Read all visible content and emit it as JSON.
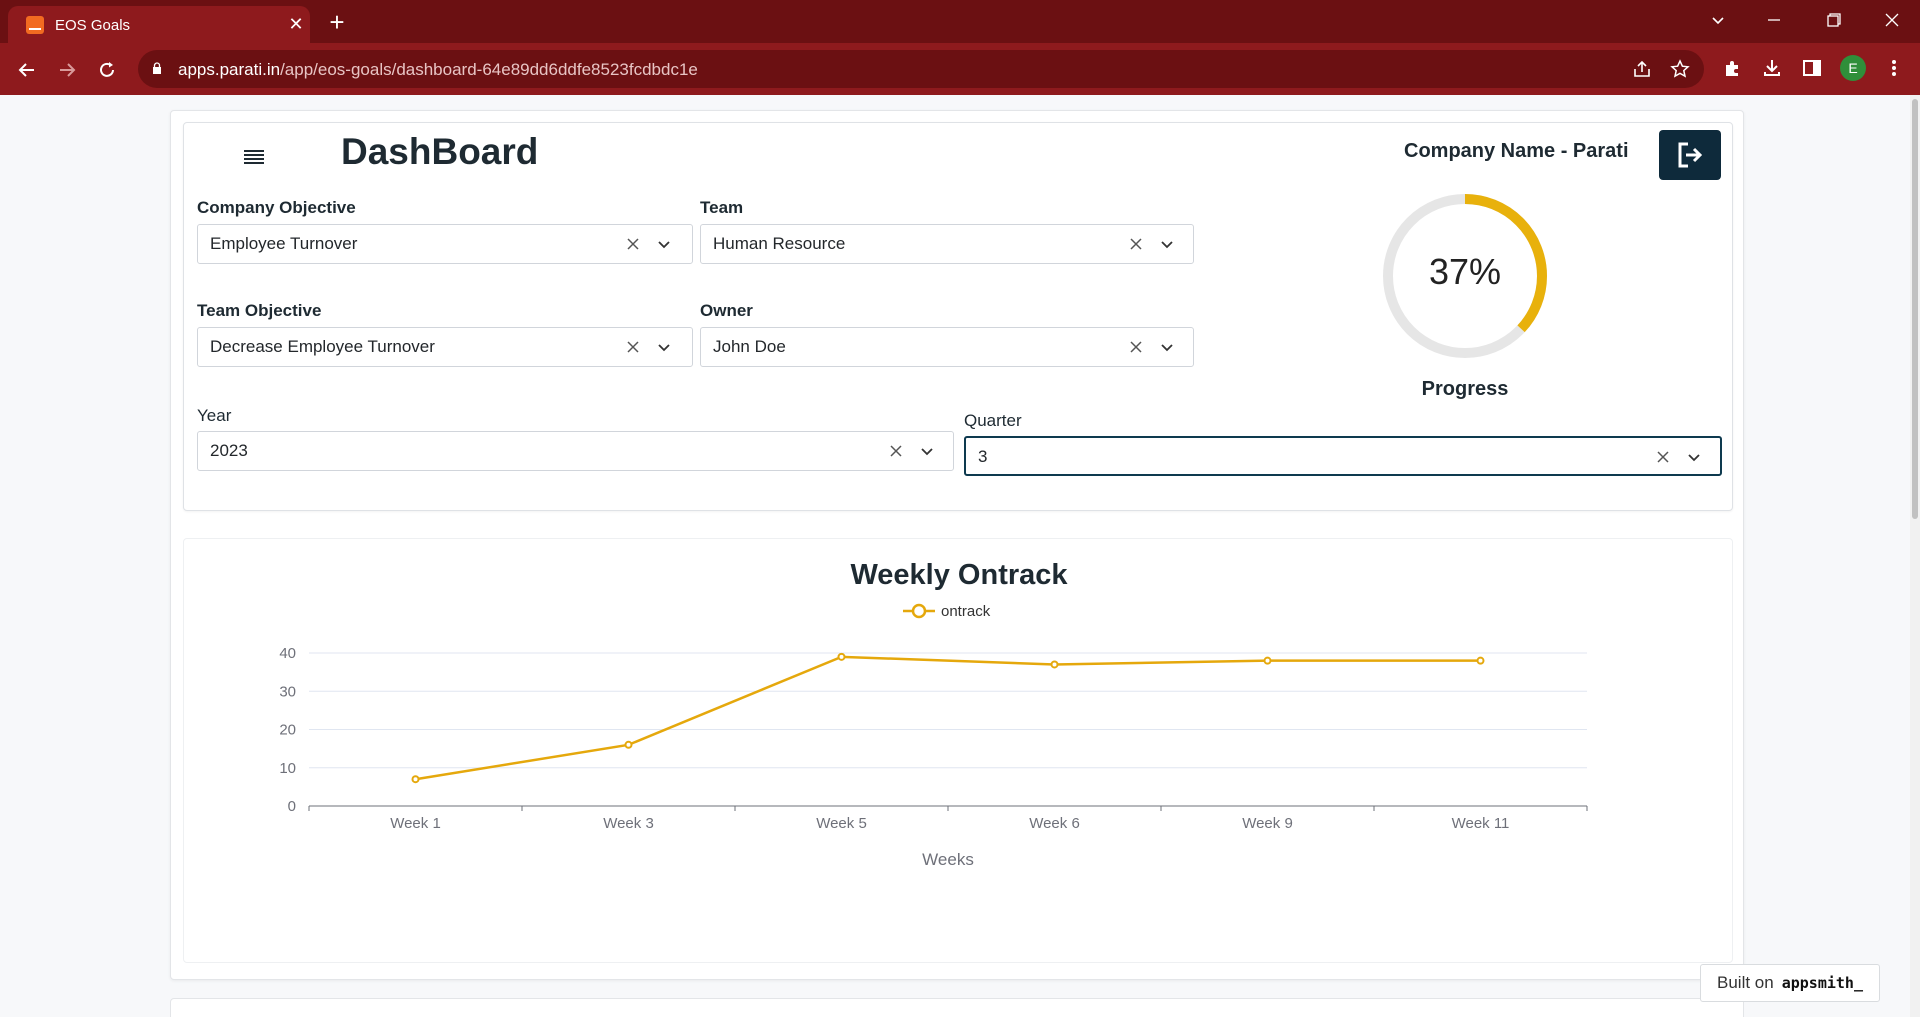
{
  "browser": {
    "tab_title": "EOS Goals",
    "url_host": "apps.parati.in",
    "url_path": "/app/eos-goals/dashboard-64e89dd6ddfe8523fcdbdc1e",
    "profile_initial": "E"
  },
  "header": {
    "title": "DashBoard",
    "company_name": "Company Name - Parati"
  },
  "filters": {
    "company_objective": {
      "label": "Company Objective",
      "value": "Employee Turnover"
    },
    "team": {
      "label": "Team",
      "value": "Human Resource"
    },
    "team_objective": {
      "label": "Team Objective",
      "value": "Decrease Employee Turnover"
    },
    "owner": {
      "label": "Owner",
      "value": "John Doe"
    },
    "year": {
      "label": "Year",
      "value": "2023"
    },
    "quarter": {
      "label": "Quarter",
      "value": "3"
    }
  },
  "progress": {
    "value": 0.37,
    "text": "37%",
    "label": "Progress",
    "color": "#e8b10c",
    "track_color": "#e6e6e6"
  },
  "chart_data": {
    "type": "line",
    "title": "Weekly Ontrack",
    "xlabel": "Weeks",
    "ylabel": "",
    "categories": [
      "Week 1",
      "Week 3",
      "Week 5",
      "Week 6",
      "Week 9",
      "Week 11"
    ],
    "series": [
      {
        "name": "ontrack",
        "values": [
          7,
          16,
          39,
          37,
          38,
          38
        ],
        "color": "#e5a80c"
      }
    ],
    "ylim": [
      0,
      40
    ],
    "yticks": [
      0,
      10,
      20,
      30,
      40
    ],
    "grid": true,
    "legend": "top-center"
  },
  "footer": {
    "built_on": "Built on",
    "brand": "appsmith_"
  }
}
